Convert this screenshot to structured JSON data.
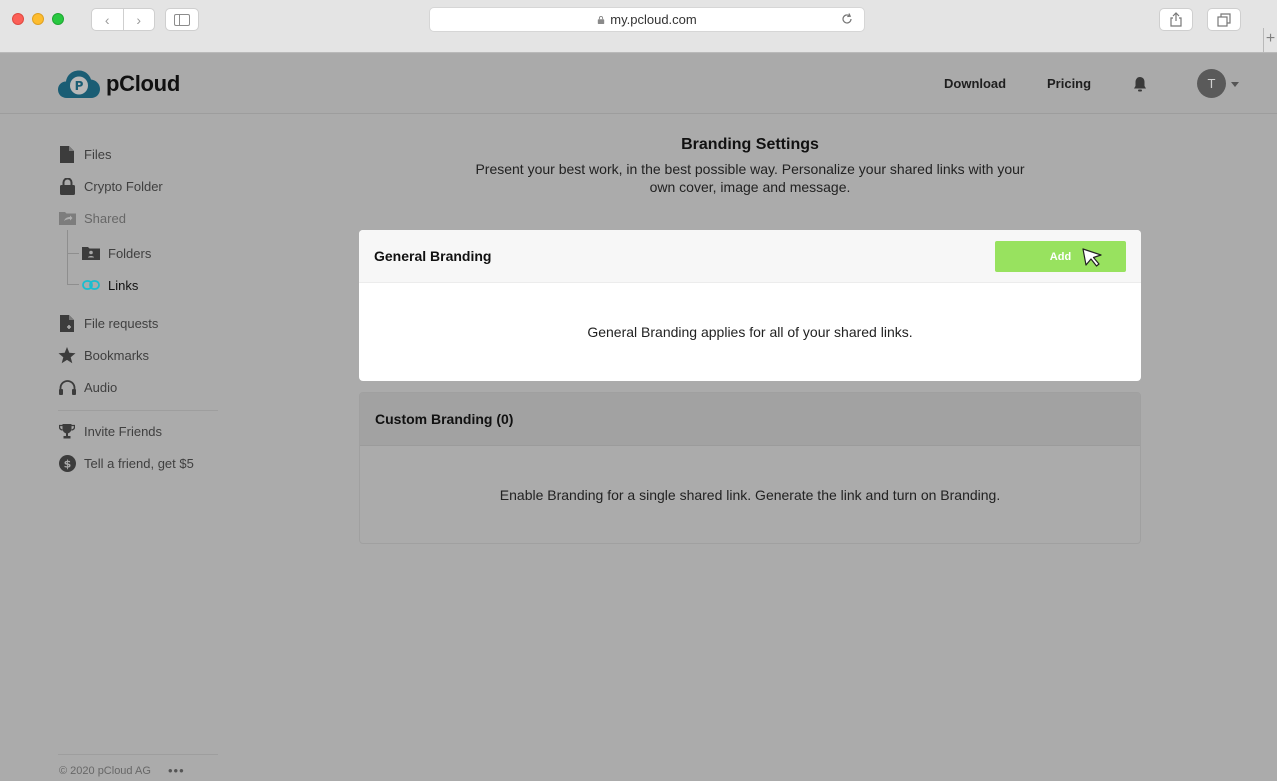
{
  "browser": {
    "url": "my.pcloud.com",
    "nav_back": "‹",
    "nav_forward": "›",
    "new_tab": "+"
  },
  "header": {
    "logo_text": "pCloud",
    "links": [
      {
        "label": "Download"
      },
      {
        "label": "Pricing"
      }
    ],
    "avatar_initial": "T"
  },
  "sidebar": {
    "items": [
      {
        "label": "Files",
        "icon": "file-icon"
      },
      {
        "label": "Crypto Folder",
        "icon": "lock-icon"
      },
      {
        "label": "Shared",
        "icon": "shared-folder-icon"
      },
      {
        "label": "Folders",
        "icon": "folder-user-icon"
      },
      {
        "label": "Links",
        "icon": "link-icon"
      },
      {
        "label": "File requests",
        "icon": "file-request-icon"
      },
      {
        "label": "Bookmarks",
        "icon": "star-icon"
      },
      {
        "label": "Audio",
        "icon": "headphones-icon"
      },
      {
        "label": "Invite Friends",
        "icon": "trophy-icon"
      },
      {
        "label": "Tell a friend, get $5",
        "icon": "dollar-icon"
      }
    ],
    "footer": "© 2020 pCloud AG",
    "more": "•••"
  },
  "main": {
    "title": "Branding Settings",
    "description": "Present your best work, in the best possible way. Personalize your shared links with your own cover, image and message.",
    "general": {
      "heading": "General Branding",
      "add_label": "Add",
      "body": "General Branding applies for all of your shared links."
    },
    "custom": {
      "heading": "Custom Branding (0)",
      "body": "Enable Branding for a single shared link. Generate the link and turn on Branding."
    }
  },
  "colors": {
    "accent_green": "#98e25f",
    "link_active": "#17bed0",
    "overlay_gray": "#ababab"
  }
}
